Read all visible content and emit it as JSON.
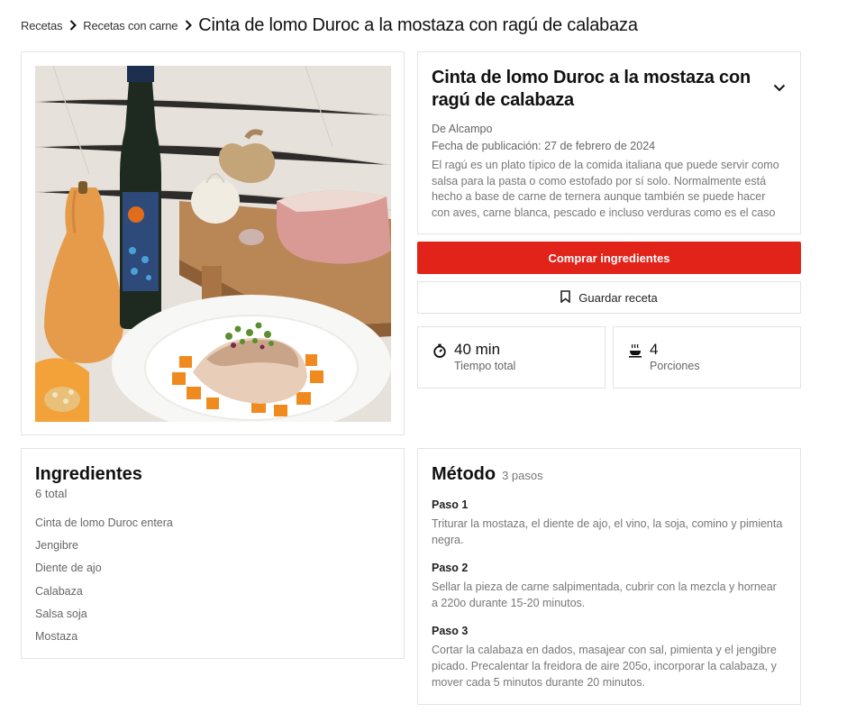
{
  "breadcrumb": {
    "items": [
      "Recetas",
      "Recetas con carne"
    ],
    "current": "Cinta de lomo Duroc a la mostaza con ragú de calabaza"
  },
  "recipe": {
    "title": "Cinta de lomo Duroc a la mostaza con ragú de calabaza",
    "author": "De Alcampo",
    "published": "Fecha de publicación: 27 de febrero de 2024",
    "description": "El ragú es un plato típico de la comida italiana que puede servir como salsa para la pasta o como estofado por sí solo. Normalmente está hecho a base de carne de ternera aunque también se puede hacer con aves, carne blanca, pescado e incluso verduras como es el caso de..."
  },
  "actions": {
    "buy_label": "Comprar ingredientes",
    "save_label": "Guardar receta"
  },
  "stats": {
    "time": {
      "value": "40 min",
      "label": "Tiempo total",
      "icon": "stopwatch-icon"
    },
    "servings": {
      "value": "4",
      "label": "Porciones",
      "icon": "dish-icon"
    }
  },
  "ingredients": {
    "title": "Ingredientes",
    "total": "6 total",
    "items": [
      "Cinta de lomo Duroc entera",
      "Jengibre",
      "Diente de ajo",
      "Calabaza",
      "Salsa soja",
      "Mostaza"
    ]
  },
  "method": {
    "title": "Método",
    "count": "3 pasos",
    "steps": [
      {
        "label": "Paso 1",
        "text": "Triturar la mostaza, el diente de ajo, el vino, la soja, comino y pimienta negra."
      },
      {
        "label": "Paso 2",
        "text": "Sellar la pieza de carne salpimentada, cubrir con la mezcla y hornear a 220o durante 15-20 minutos."
      },
      {
        "label": "Paso 3",
        "text": "Cortar la calabaza en dados, masajear con sal, pimienta y el jengibre picado. Precalentar la freidora de aire 205o, incorporar la calabaza, y mover cada 5 minutos durante 20 minutos."
      }
    ]
  },
  "colors": {
    "accent": "#e2231a",
    "border": "#e3e3e3",
    "muted_text": "#666666"
  }
}
